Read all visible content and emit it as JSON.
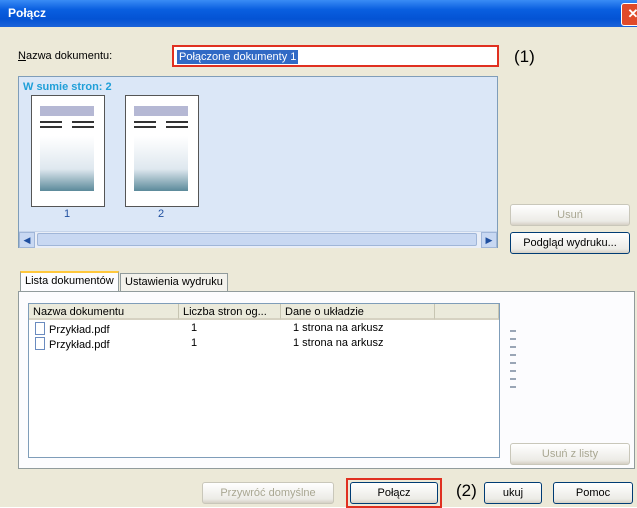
{
  "window": {
    "title": "Połącz",
    "close_glyph": "✕"
  },
  "document_name": {
    "label_prefix": "N",
    "label_rest": "azwa dokumentu:",
    "value": "Połączone dokumenty 1",
    "marker": "(1)"
  },
  "preview": {
    "total_pages": "W sumie stron: 2",
    "pages": [
      "1",
      "2"
    ],
    "scroll_left": "◀",
    "scroll_right": "▶"
  },
  "side_buttons": {
    "delete": "Usuń",
    "print_preview": "Podgląd wydruku..."
  },
  "tabs": [
    "Lista dokumentów",
    "Ustawienia wydruku"
  ],
  "table": {
    "columns": [
      "Nazwa dokumentu",
      "Liczba stron og...",
      "Dane o układzie"
    ],
    "rows": [
      {
        "name": "Przykład.pdf",
        "pages": "1",
        "layout": "1 strona na arkusz"
      },
      {
        "name": "Przykład.pdf",
        "pages": "1",
        "layout": "1 strona na arkusz"
      }
    ]
  },
  "remove_from_list": "Usuń z listy",
  "footer": {
    "restore_defaults": "Przywróć domyślne",
    "combine": "Połącz",
    "marker": "(2)",
    "print_partial": "ukuj",
    "help": "Pomoc"
  }
}
